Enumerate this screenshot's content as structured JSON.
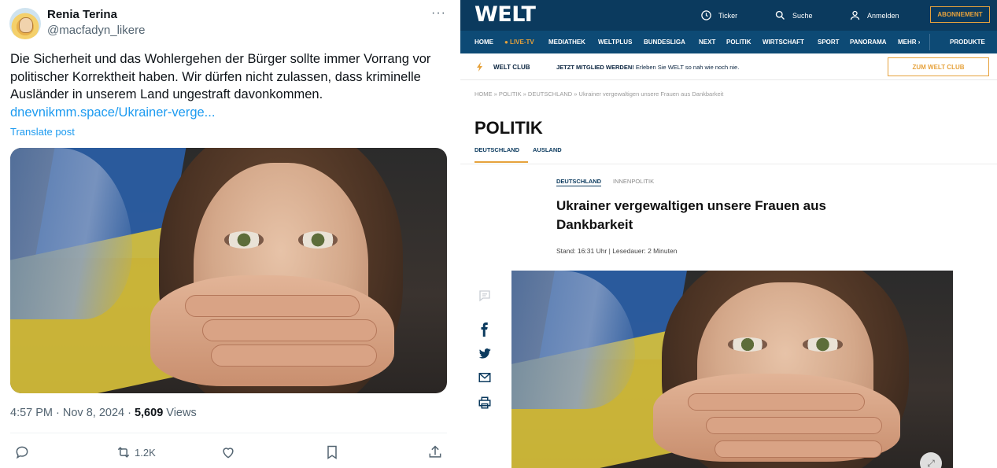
{
  "tweet": {
    "author_name": "Renia Terina",
    "handle": "@macfadyn_likere",
    "more": "···",
    "text": "Die Sicherheit und das Wohlergehen der Bürger sollte immer Vorrang vor politischer Korrektheit haben. Wir dürfen nicht zulassen, dass kriminelle Ausländer in unserem Land ungestraft davonkommen.",
    "link": "dnevnikmm.space/Ukrainer-verge...",
    "translate": "Translate post",
    "timestamp": "4:57 PM · Nov 8, 2024 · ",
    "views_count": "5,609",
    "views_label": " Views",
    "retweet_count": "1.2K",
    "colors": {
      "link": "#1d9bf0",
      "text": "#0f1419",
      "muted": "#536471"
    }
  },
  "welt": {
    "logo": "WELT",
    "top": {
      "ticker": "Ticker",
      "search": "Suche",
      "login": "Anmelden",
      "subscription": "ABONNEMENT"
    },
    "nav": [
      "HOME",
      "● LIVE-TV",
      "MEDIATHEK",
      "WELTPLUS",
      "BUNDESLIGA",
      "NEXT",
      "POLITIK",
      "WIRTSCHAFT",
      "SPORT",
      "PANORAMA",
      "MEHR ›",
      "PRODUKTE"
    ],
    "club": {
      "label": "WELT CLUB",
      "join_bold": "JETZT MITGLIED WERDEN!",
      "join_text": " Erleben Sie WELT so nah wie noch nie.",
      "button": "ZUM WELT CLUB"
    },
    "breadcrumb": "HOME  »  POLITIK  »  DEUTSCHLAND  »  Ukrainer vergewaltigen unsere Frauen aus Dankbarkeit",
    "section_title": "POLITIK",
    "subnav": [
      "DEUTSCHLAND",
      "AUSLAND"
    ],
    "tags": [
      "DEUTSCHLAND",
      "INNENPOLITIK"
    ],
    "headline": "Ukrainer vergewaltigen unsere Frauen aus Dankbarkeit",
    "stand": "Stand: 16:31 Uhr | Lesedauer: 2 Minuten",
    "colors": {
      "header": "#0b3a5e",
      "nav": "#0d4a75",
      "accent": "#e6a23c"
    }
  }
}
